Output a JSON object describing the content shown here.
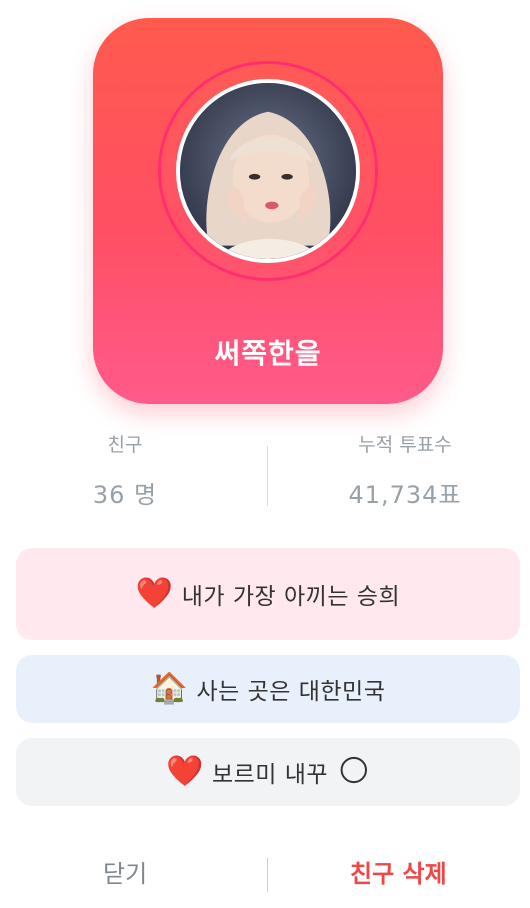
{
  "profile": {
    "name": "써쪽한을",
    "avatar_alt": "profile-photo"
  },
  "stats": {
    "friends_label": "친구",
    "friends_value": "36 명",
    "votes_label": "누적 투표수",
    "votes_value": "41,734표"
  },
  "pills": [
    {
      "emoji": "❤️",
      "text": "내가 가장 아끼는 승희"
    },
    {
      "emoji": "🏠",
      "text": "사는 곳은 대한민국"
    },
    {
      "emoji": "❤️",
      "text": "보르미 내꾸",
      "emoji_after": "🌕"
    }
  ],
  "footer": {
    "close_label": "닫기",
    "delete_label": "친구 삭제"
  },
  "colors": {
    "card_top": "#ff5a4e",
    "card_bottom": "#ff5a8c",
    "delete": "#f04646",
    "muted": "#98a0a8"
  }
}
